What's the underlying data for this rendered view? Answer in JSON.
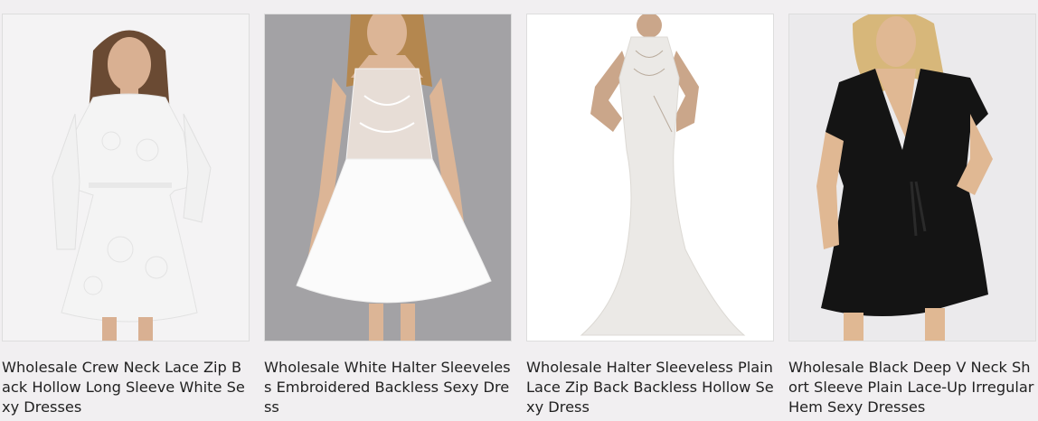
{
  "products": [
    {
      "title": "Wholesale Crew Neck Lace Zip Back Hollow Long Sleeve White Sexy Dresses",
      "image_alt": "Model in white lace long sleeve dress",
      "dress_color": "#f4f4f4",
      "bg_color": "#f4f3f4"
    },
    {
      "title": "Wholesale White Halter Sleeveless Embroidered Backless Sexy Dress",
      "image_alt": "Model in white halter embroidered dress",
      "dress_color": "#fbfbfb",
      "bg_color": "#a3a2a5"
    },
    {
      "title": "Wholesale Halter Sleeveless Plain Lace Zip Back Backless Hollow Sexy Dress",
      "image_alt": "Model in white mermaid gown",
      "dress_color": "#ebe9e6",
      "bg_color": "#ffffff"
    },
    {
      "title": "Wholesale Black Deep V Neck Short Sleeve Plain Lace-Up Irregular Hem Sexy Dresses",
      "image_alt": "Model in black wrap dress",
      "dress_color": "#141414",
      "bg_color": "#ebeaec"
    }
  ]
}
